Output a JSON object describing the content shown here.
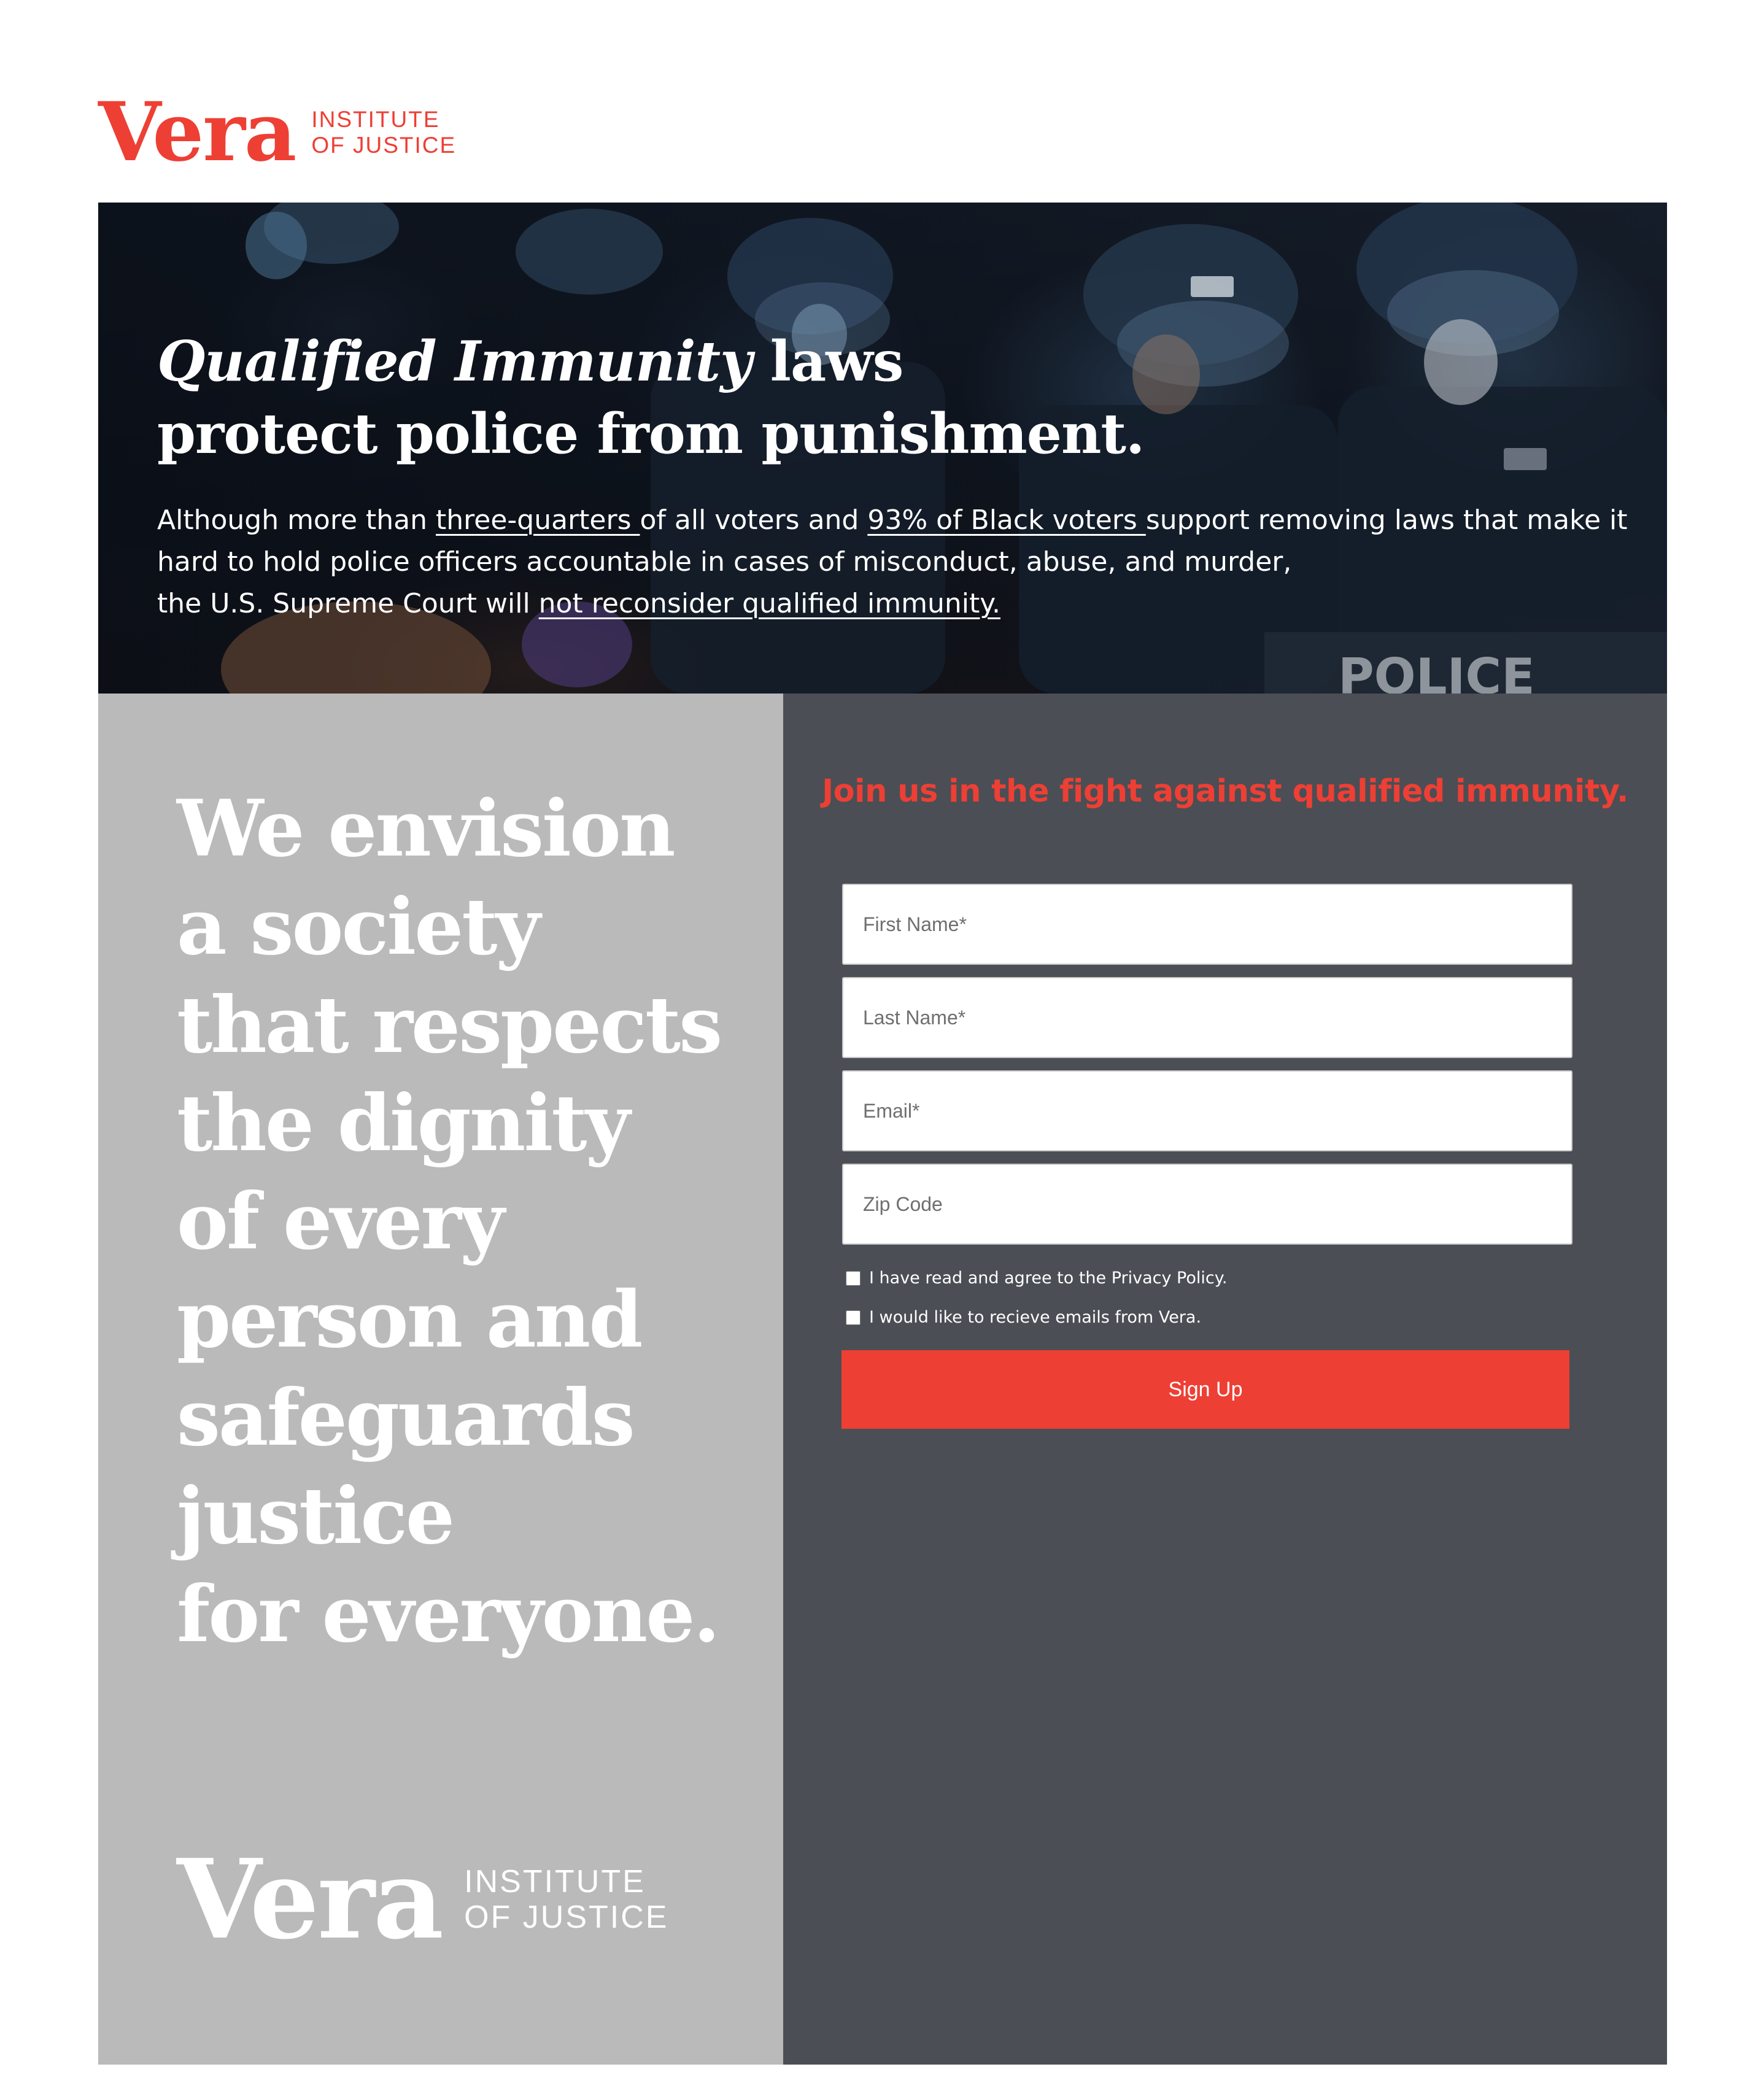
{
  "brand": {
    "wordmark": "Vera",
    "sub_line1": "INSTITUTE",
    "sub_line2": "OF JUSTICE",
    "accent_color": "#ee3f34"
  },
  "hero": {
    "title_italic": "Qualified Immunity",
    "title_rest_line1": " laws",
    "title_line2": "protect police from punishment.",
    "text_part1": "Although more than ",
    "link1": "three-quarters ",
    "text_part2": "of all voters and ",
    "link2": "93% of Black voters ",
    "text_part3": "support removing laws that make it",
    "text_line2": "hard to hold police officers accountable in cases of misconduct, abuse, and murder,",
    "text_line3_prefix": "the U.S. Supreme Court will ",
    "link3": "not reconsider qualified immunity."
  },
  "vision": {
    "lines": [
      "We envision",
      "a society",
      "that respects",
      "the dignity",
      "of every",
      "person and",
      "safeguards",
      "justice",
      "for everyone."
    ],
    "panel_color": "#bababa"
  },
  "form": {
    "heading": "Join us in the fight against qualified immunity.",
    "first_name_placeholder": "First Name*",
    "last_name_placeholder": "Last Name*",
    "email_placeholder": "Email*",
    "zip_placeholder": "Zip Code",
    "privacy_label": "I have read and agree to the Privacy Policy.",
    "emails_label": "I would like to recieve emails from Vera.",
    "submit_label": "Sign Up",
    "panel_color": "#4b4e55"
  }
}
